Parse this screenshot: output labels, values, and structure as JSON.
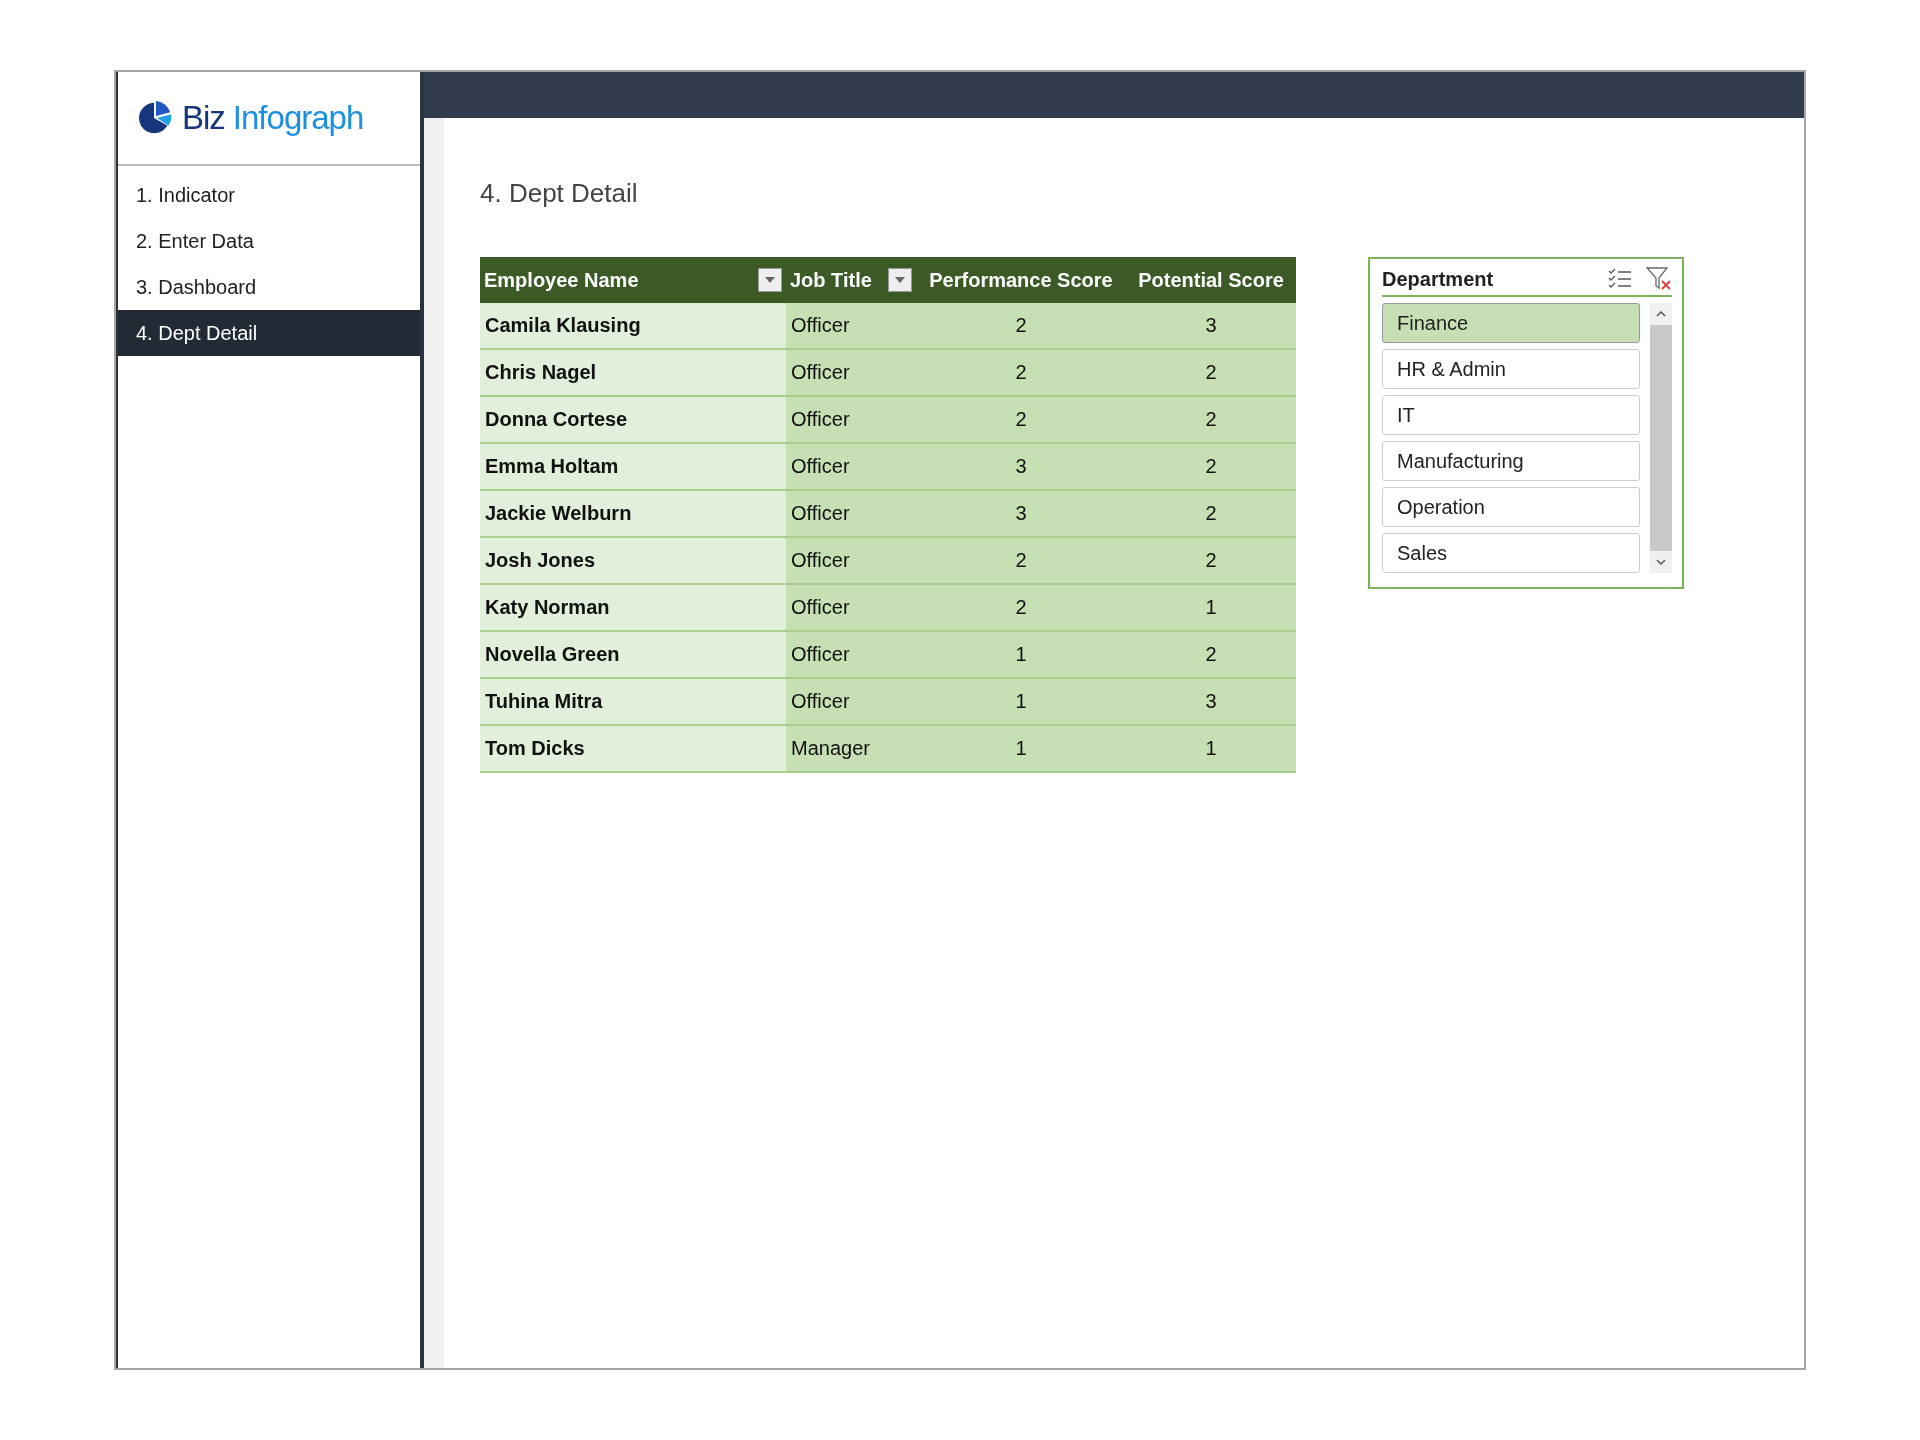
{
  "logo": {
    "word_1": "Biz",
    "word_2": "Infograph"
  },
  "sidebar": {
    "items": [
      {
        "label": "1. Indicator",
        "selected": false
      },
      {
        "label": "2. Enter Data",
        "selected": false
      },
      {
        "label": "3. Dashboard",
        "selected": false
      },
      {
        "label": "4. Dept Detail",
        "selected": true
      }
    ]
  },
  "page_title": "4. Dept Detail",
  "table": {
    "columns": [
      {
        "label": "Employee Name",
        "filter": true
      },
      {
        "label": "Job Title",
        "filter": true
      },
      {
        "label": "Performance Score",
        "filter": false
      },
      {
        "label": "Potential Score",
        "filter": false
      }
    ],
    "rows": [
      [
        "Camila Klausing",
        "Officer",
        "2",
        "3"
      ],
      [
        "Chris Nagel",
        "Officer",
        "2",
        "2"
      ],
      [
        "Donna Cortese",
        "Officer",
        "2",
        "2"
      ],
      [
        "Emma Holtam",
        "Officer",
        "3",
        "2"
      ],
      [
        "Jackie Welburn",
        "Officer",
        "3",
        "2"
      ],
      [
        "Josh Jones",
        "Officer",
        "2",
        "2"
      ],
      [
        "Katy Norman",
        "Officer",
        "2",
        "1"
      ],
      [
        "Novella Green",
        "Officer",
        "1",
        "2"
      ],
      [
        "Tuhina Mitra",
        "Officer",
        "1",
        "3"
      ],
      [
        "Tom Dicks",
        "Manager",
        "1",
        "1"
      ]
    ]
  },
  "slicer": {
    "title": "Department",
    "items": [
      {
        "label": "Finance",
        "selected": true
      },
      {
        "label": "HR & Admin",
        "selected": false
      },
      {
        "label": "IT",
        "selected": false
      },
      {
        "label": "Manufacturing",
        "selected": false
      },
      {
        "label": "Operation",
        "selected": false
      },
      {
        "label": "Sales",
        "selected": false
      }
    ]
  }
}
